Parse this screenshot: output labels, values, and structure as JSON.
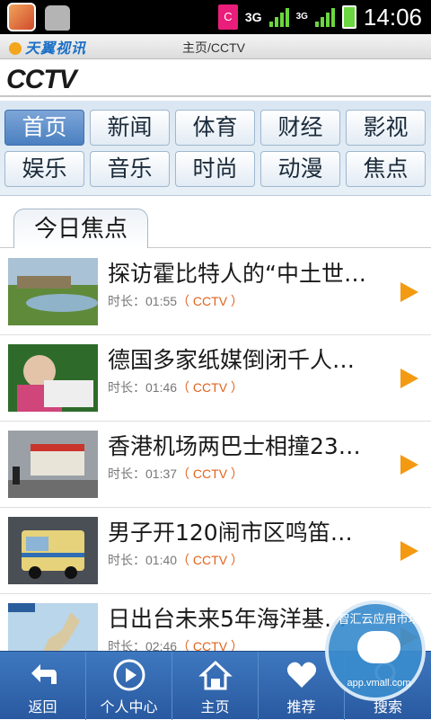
{
  "status_bar": {
    "network": "3G",
    "network_small": "3G",
    "time": "14:06",
    "notification_letter": "C"
  },
  "header": {
    "brand": "天翼视讯",
    "breadcrumb": "主页/CCTV",
    "channel_logo": "CCTV"
  },
  "categories": [
    "首页",
    "新闻",
    "体育",
    "财经",
    "影视",
    "娱乐",
    "音乐",
    "时尚",
    "动漫",
    "焦点"
  ],
  "active_category": "首页",
  "section": {
    "title": "今日焦点"
  },
  "list": [
    {
      "title": "探访霍比特人的“中土世…",
      "duration_label": "时长：01:55",
      "source": "（ CCTV ）"
    },
    {
      "title": "德国多家纸媒倒闭千人…",
      "duration_label": "时长：01:46",
      "source": "（ CCTV ）"
    },
    {
      "title": "香港机场两巴士相撞23…",
      "duration_label": "时长：01:37",
      "source": "（ CCTV ）"
    },
    {
      "title": "男子开120闹市区鸣笛…",
      "duration_label": "时长：01:40",
      "source": "（ CCTV ）"
    },
    {
      "title": "日出台未来5年海洋基…",
      "duration_label": "时长：02:46",
      "source": "（ CCTV ）"
    }
  ],
  "bottom_nav": [
    {
      "label": "返回",
      "icon": "back-arrow-icon"
    },
    {
      "label": "个人中心",
      "icon": "play-circle-icon"
    },
    {
      "label": "主页",
      "icon": "home-icon"
    },
    {
      "label": "推荐",
      "icon": "heart-icon"
    },
    {
      "label": "搜索",
      "icon": "search-icon"
    }
  ],
  "watermark": {
    "name": "智汇云应用市场",
    "url": "app.vmall.com"
  },
  "colors": {
    "accent": "#2959a0",
    "play": "#f39a12",
    "source": "#e2621b"
  }
}
